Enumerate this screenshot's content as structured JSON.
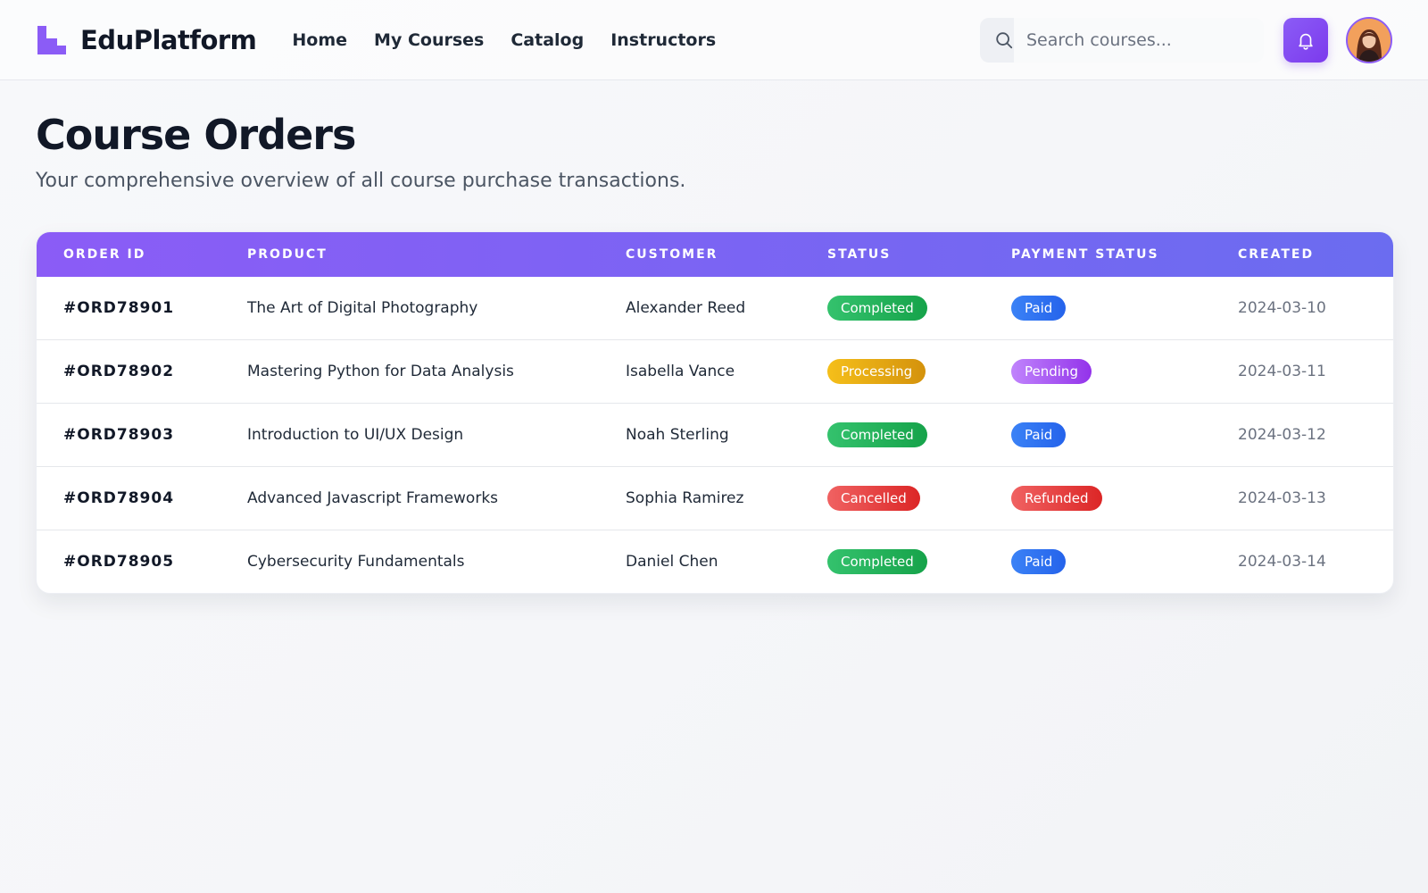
{
  "header": {
    "brand": "EduPlatform",
    "nav": [
      {
        "label": "Home"
      },
      {
        "label": "My Courses"
      },
      {
        "label": "Catalog"
      },
      {
        "label": "Instructors"
      }
    ],
    "search": {
      "placeholder": "Search courses..."
    },
    "icons": {
      "logo": "eduplatform-logo",
      "search": "search-icon",
      "notifications": "bell-icon",
      "avatar": "user-avatar"
    }
  },
  "main": {
    "title": "Course Orders",
    "subtitle": "Your comprehensive overview of all course purchase transactions."
  },
  "table": {
    "columns": [
      "ORDER ID",
      "PRODUCT",
      "CUSTOMER",
      "STATUS",
      "PAYMENT STATUS",
      "CREATED"
    ],
    "rows": [
      {
        "order_id": "#ORD78901",
        "product": "The Art of Digital Photography",
        "customer": "Alexander Reed",
        "status": "Completed",
        "status_color": "#22b35e",
        "payment": "Paid",
        "payment_color": "#3b82f6",
        "created": "2024-03-10"
      },
      {
        "order_id": "#ORD78902",
        "product": "Mastering Python for Data Analysis",
        "customer": "Isabella Vance",
        "status": "Processing",
        "status_color": "#e6a812",
        "payment": "Pending",
        "payment_color": "#a855f7",
        "created": "2024-03-11"
      },
      {
        "order_id": "#ORD78903",
        "product": "Introduction to UI/UX Design",
        "customer": "Noah Sterling",
        "status": "Completed",
        "status_color": "#22b35e",
        "payment": "Paid",
        "payment_color": "#3b82f6",
        "created": "2024-03-12"
      },
      {
        "order_id": "#ORD78904",
        "product": "Advanced Javascript Frameworks",
        "customer": "Sophia Ramirez",
        "status": "Cancelled",
        "status_color": "#ef4444",
        "payment": "Refunded",
        "payment_color": "#ef4444",
        "created": "2024-03-13"
      },
      {
        "order_id": "#ORD78905",
        "product": "Cybersecurity Fundamentals",
        "customer": "Daniel Chen",
        "status": "Completed",
        "status_color": "#22b35e",
        "payment": "Paid",
        "payment_color": "#3b82f6",
        "created": "2024-03-14"
      }
    ]
  },
  "colors": {
    "accent": "#8b5cf6",
    "header_gradient_start": "#8b5cf6",
    "header_gradient_end": "#6b6cf0"
  }
}
